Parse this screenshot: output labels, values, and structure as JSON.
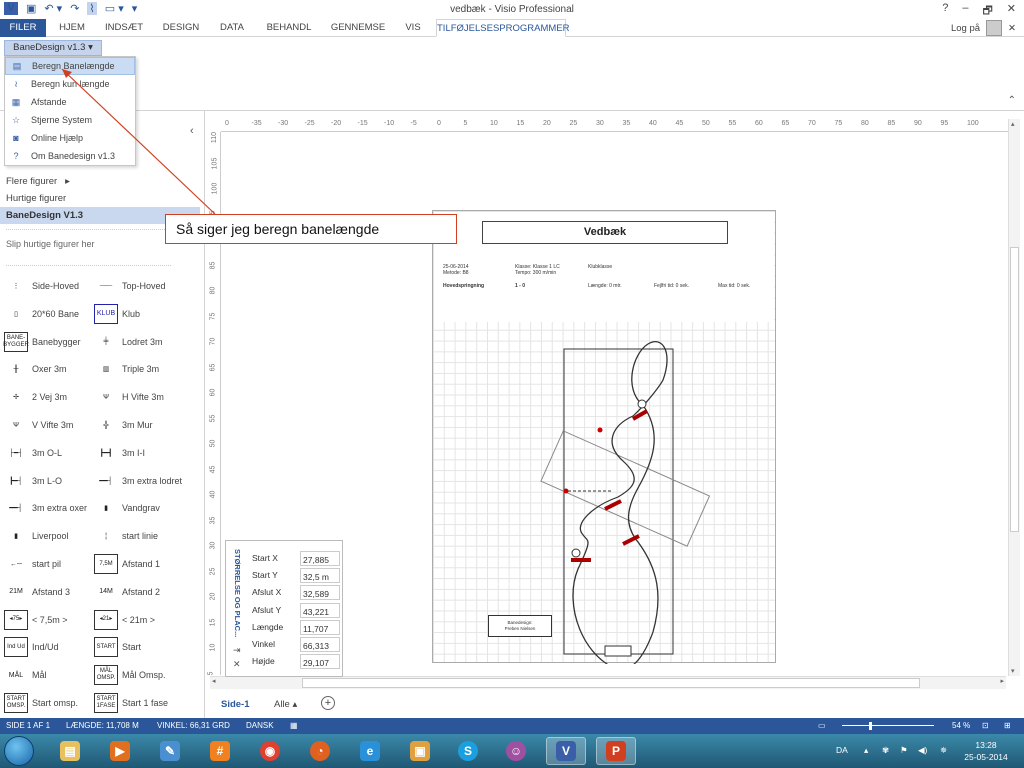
{
  "window": {
    "title": "vedbæk - Visio Professional",
    "help": "?",
    "minimize": "–",
    "restore": "🗗",
    "close": "✕"
  },
  "qat": {
    "visio_logo": "V",
    "save_icon": "save-icon",
    "undo_icon": "undo-icon",
    "redo_icon": "redo-icon"
  },
  "ribbon_tabs": [
    "FILER",
    "HJEM",
    "INDSÆT",
    "DESIGN",
    "DATA",
    "BEHANDL",
    "GENNEMSE",
    "VIS",
    "TILFØJELSESPROGRAMMER"
  ],
  "active_tab": "TILFØJELSESPROGRAMMER",
  "login": {
    "label": "Log på",
    "close": "✕"
  },
  "addin": {
    "button_label": "BaneDesign v1.3 ▾"
  },
  "addin_menu": [
    {
      "label": "Beregn Banelængde",
      "icon": "calculator-icon",
      "highlighted": true
    },
    {
      "label": "Beregn kun længde",
      "icon": "curve-icon",
      "highlighted": false
    },
    {
      "label": "Afstande",
      "icon": "grid-icon",
      "highlighted": false
    },
    {
      "label": "Stjerne System",
      "icon": "star-icon",
      "highlighted": false
    },
    {
      "label": "Online Hjælp",
      "icon": "globe-icon",
      "highlighted": false
    },
    {
      "label": "Om Banedesign v1.3",
      "icon": "help-icon",
      "highlighted": false
    }
  ],
  "shapes_panel": {
    "more_shapes": "Flere figurer",
    "quick_shapes": "Hurtige figurer",
    "selected_stencil": "BaneDesign V1.3",
    "drop_hint": "Slip hurtige figurer her",
    "stencils": [
      {
        "label": "Side-Hoved",
        "glyph": "⋮"
      },
      {
        "label": "Top-Hoved",
        "glyph": "┈┈┈"
      },
      {
        "label": "20*60 Bane",
        "glyph": "▯"
      },
      {
        "label": "Klub",
        "glyph": "KLUB"
      },
      {
        "label": "Banebygger",
        "glyph": "BANE-BYGGER"
      },
      {
        "label": "Lodret 3m",
        "glyph": "╪"
      },
      {
        "label": "Oxer 3m",
        "glyph": "╫"
      },
      {
        "label": "Triple 3m",
        "glyph": "▥"
      },
      {
        "label": "2 Vej 3m",
        "glyph": "✢"
      },
      {
        "label": "H Vifte 3m",
        "glyph": "Ψ"
      },
      {
        "label": "V Vifte 3m",
        "glyph": "Ψ"
      },
      {
        "label": "3m Mur",
        "glyph": "╬"
      },
      {
        "label": "3m O-L",
        "glyph": "├━┤"
      },
      {
        "label": "3m I-I",
        "glyph": "┣━┫"
      },
      {
        "label": "3m L-O",
        "glyph": "┣━┤"
      },
      {
        "label": "3m extra lodret",
        "glyph": "━━┤"
      },
      {
        "label": "3m extra oxer",
        "glyph": "━━┤"
      },
      {
        "label": "Vandgrav",
        "glyph": "▮"
      },
      {
        "label": "Liverpool",
        "glyph": "▮"
      },
      {
        "label": "start linie",
        "glyph": "¦"
      },
      {
        "label": "start pil",
        "glyph": "←─"
      },
      {
        "label": "Afstand 1",
        "glyph": "7,5M"
      },
      {
        "label": "Afstand 3",
        "glyph": "21M"
      },
      {
        "label": "Afstand 2",
        "glyph": "14M"
      },
      {
        "label": "< 7,5m >",
        "glyph": "◂75▸"
      },
      {
        "label": "< 21m >",
        "glyph": "◂21▸"
      },
      {
        "label": "Ind/Ud",
        "glyph": "Ind Ud"
      },
      {
        "label": "Start",
        "glyph": "START"
      },
      {
        "label": "Mål",
        "glyph": "MÅL"
      },
      {
        "label": "Mål Omsp.",
        "glyph": "MÅL OMSP."
      },
      {
        "label": "Start omsp.",
        "glyph": "START OMSP."
      },
      {
        "label": "Start 1 fase",
        "glyph": "START 1FASE"
      }
    ]
  },
  "callout": {
    "text": "Så siger jeg beregn banelængde"
  },
  "ruler": {
    "h": [
      "0",
      "-35",
      "-30",
      "-25",
      "-20",
      "-15",
      "-10",
      "-5",
      "0",
      "5",
      "10",
      "15",
      "20",
      "25",
      "30",
      "35",
      "40",
      "45",
      "50",
      "55",
      "60",
      "65",
      "70",
      "75",
      "80",
      "85",
      "90",
      "95",
      "100"
    ],
    "v": [
      "110",
      "105",
      "100",
      "95",
      "90",
      "85",
      "80",
      "75",
      "70",
      "65",
      "60",
      "55",
      "50",
      "45",
      "40",
      "35",
      "30",
      "25",
      "20",
      "15",
      "10",
      "5",
      "0"
    ]
  },
  "size_panel": {
    "title": "STØRRELSE OG PLAC...",
    "rows": [
      {
        "label": "Start X",
        "value": "27,885"
      },
      {
        "label": "Start Y",
        "value": "32,5 m"
      },
      {
        "label": "Afslut X",
        "value": "32,589"
      },
      {
        "label": "Afslut Y",
        "value": "43,221"
      },
      {
        "label": "Længde",
        "value": "11,707"
      },
      {
        "label": "Vinkel",
        "value": "66,313"
      },
      {
        "label": "Højde",
        "value": "29,107"
      }
    ],
    "pin_icon": "pin-icon",
    "close_icon": "close-icon"
  },
  "course_page": {
    "title": "Vedbæk",
    "date": "25-06-2014",
    "method": "Metode: B8",
    "klasse": "Klasse: Klasse 1 LC",
    "tempo": "Tempo: 300 m/min",
    "klubklasse": "Klubklasse",
    "hoved": "Hovedspringning",
    "range": "1 - 0",
    "laengde": "Længde: 0 mtr.",
    "fejlfri": "Fejlfri tid: 0 sek.",
    "max": "Max tid: 0 sek.",
    "stamp_line1": "Banedesign:",
    "stamp_line2": "Preben Nielsen"
  },
  "page_tabs": {
    "active": "Side-1",
    "all": "Alle ▴",
    "add_icon": "plus-icon"
  },
  "status": {
    "page": "SIDE 1 AF 1",
    "length": "LÆNGDE: 11,708 M",
    "angle": "VINKEL: 66,31 GRD",
    "language": "DANSK",
    "zoom": "54 %"
  },
  "tray": {
    "lang": "DA",
    "time": "13:28",
    "date": "25-05-2014"
  }
}
